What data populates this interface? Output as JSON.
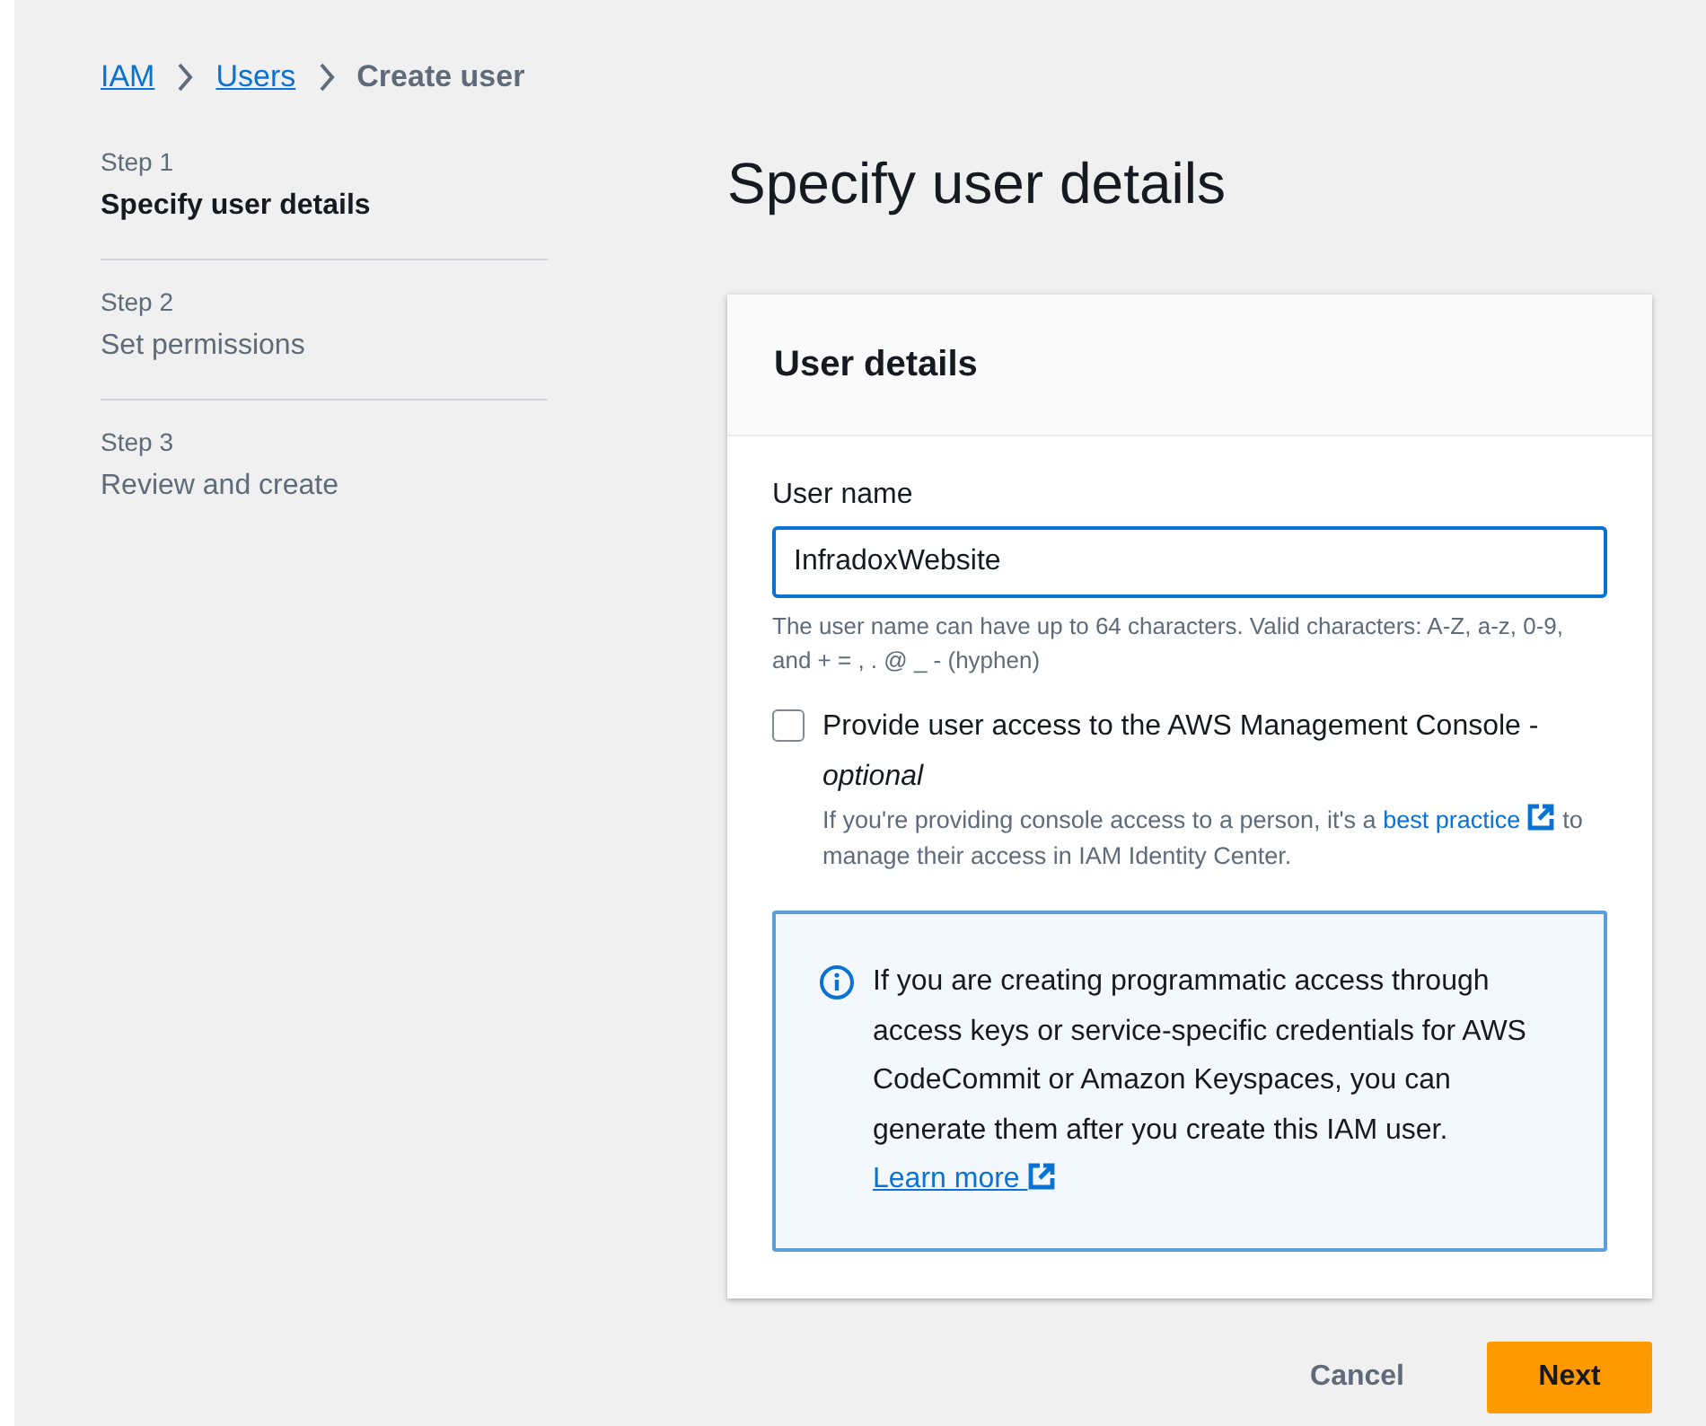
{
  "breadcrumb": [
    {
      "label": "IAM",
      "kind": "link"
    },
    {
      "label": "Users",
      "kind": "link"
    },
    {
      "label": "Create user",
      "kind": "current"
    }
  ],
  "steps": [
    {
      "step": "Step 1",
      "title": "Specify user details",
      "selected": true
    },
    {
      "step": "Step 2",
      "title": "Set permissions",
      "selected": false
    },
    {
      "step": "Step 3",
      "title": "Review and create",
      "selected": false
    }
  ],
  "page_title": "Specify user details",
  "card": {
    "title": "User details",
    "user_name": {
      "label": "User name",
      "value": "InfradoxWebsite",
      "hint": "The user name can have up to 64 characters. Valid characters: A-Z, a-z, 0-9, and + = , . @ _ - (hyphen)"
    },
    "console_access": {
      "label": "Provide user access to the AWS Management Console -",
      "optional": "optional",
      "checked": false,
      "description_before": "If you're providing console access to a person, it's a",
      "link": "best practice",
      "description_after": "to manage their access in IAM Identity Center."
    },
    "info": {
      "text": "If you are creating programmatic access through access keys or service-specific credentials for AWS CodeCommit or Amazon Keyspaces, you can generate them after you create this IAM user.",
      "link": "Learn more"
    }
  },
  "buttons": [
    {
      "label": "Cancel",
      "kind": "secondary"
    },
    {
      "label": "Next",
      "kind": "primary"
    }
  ]
}
